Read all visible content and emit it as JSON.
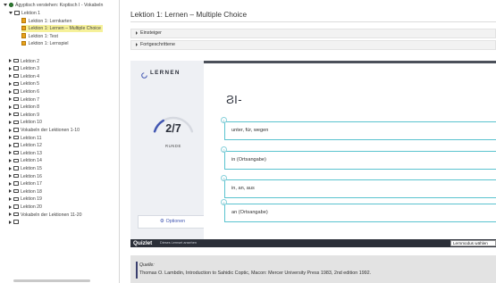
{
  "tree": {
    "root": "Ägyptisch verstehen: Koptisch I - Vokabeln",
    "items": [
      {
        "label": "Lektion 1",
        "state": "open",
        "children": [
          {
            "label": "Lektion 1: Lernkarten"
          },
          {
            "label": "Lektion 1: Lernen – Multiple Choice",
            "active": true
          },
          {
            "label": "Lektion 1: Test"
          },
          {
            "label": "Lektion 1: Lernspiel"
          }
        ]
      },
      {
        "label": "Lektion 2"
      },
      {
        "label": "Lektion 3"
      },
      {
        "label": "Lektion 4"
      },
      {
        "label": "Lektion 5"
      },
      {
        "label": "Lektion 6"
      },
      {
        "label": "Lektion 7"
      },
      {
        "label": "Lektion 8"
      },
      {
        "label": "Lektion 9"
      },
      {
        "label": "Lektion 10"
      },
      {
        "label": "Vokabeln der Lektionen 1-10"
      },
      {
        "label": "Lektion 11"
      },
      {
        "label": "Lektion 12"
      },
      {
        "label": "Lektion 13"
      },
      {
        "label": "Lektion 14"
      },
      {
        "label": "Lektion 15"
      },
      {
        "label": "Lektion 16"
      },
      {
        "label": "Lektion 17"
      },
      {
        "label": "Lektion 18"
      },
      {
        "label": "Lektion 19"
      },
      {
        "label": "Lektion 20"
      },
      {
        "label": "Vokabeln der Lektionen 11-20"
      }
    ]
  },
  "page": {
    "title": "Lektion 1: Lernen – Multiple Choice"
  },
  "sections": [
    "Einsteiger",
    "Fortgeschrittene"
  ],
  "quizlet": {
    "mode_title": "LERNEN",
    "progress": {
      "value": "2/7",
      "current": 2,
      "total": 7,
      "label": "RUNDE"
    },
    "options_label": "Optionen",
    "options_icon": "gear-icon",
    "term": "ϨΙ-",
    "answers": [
      {
        "num": "1",
        "text": "unter, für, wegen"
      },
      {
        "num": "2",
        "text": "in (Ortsangabe)"
      },
      {
        "num": "3",
        "text": "in, an, aus"
      },
      {
        "num": "4",
        "text": "an (Ortsangabe)"
      }
    ],
    "footer": {
      "logo": "Quizlet",
      "link": "Dieses Lernset ansehen",
      "mode_select": "Lernmodus wählen"
    }
  },
  "source": {
    "label": "Quelle:",
    "text": "Thomas O. Lambdin, Introduction to Sahidic Coptic, Macon: Mercer University Press 1983, 2nd edition 1992."
  },
  "colors": {
    "active_highlight": "#f6f19a",
    "accent_teal": "#5ac3cf",
    "quizlet_dark": "#2b2f38",
    "progress_blue": "#4257b2"
  }
}
